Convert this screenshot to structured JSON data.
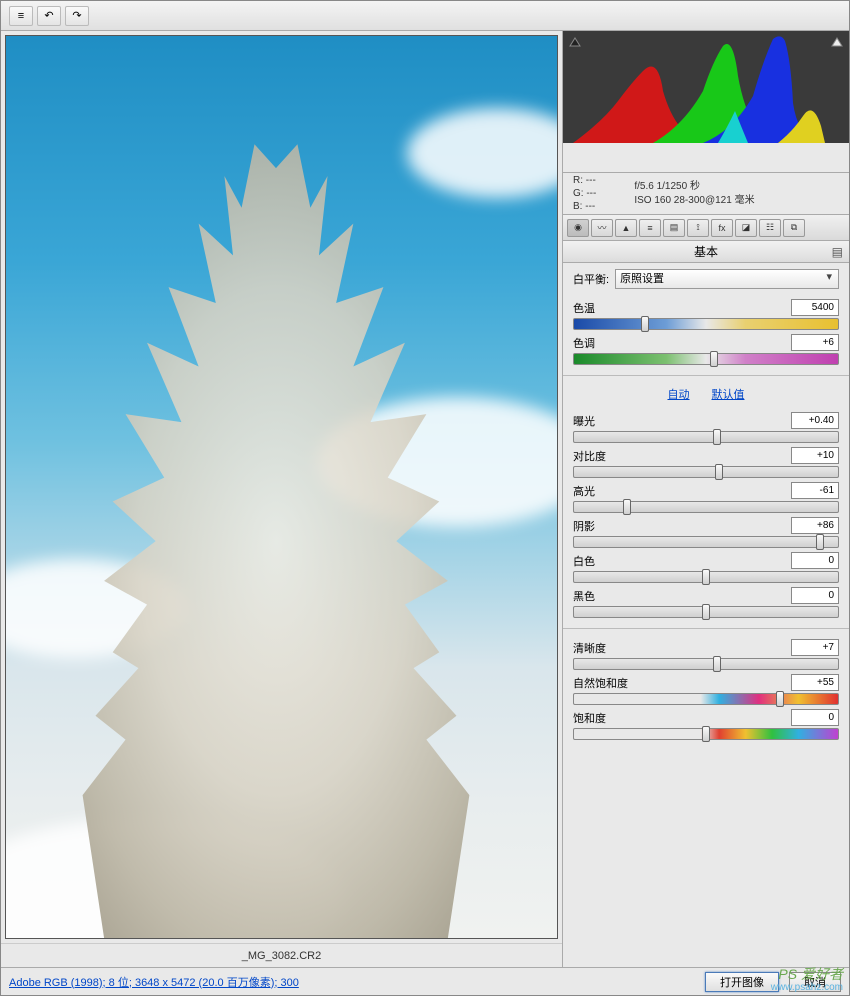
{
  "toolbar": {
    "menu_glyph": "≡",
    "undo_glyph": "↶",
    "redo_glyph": "↷"
  },
  "preview": {
    "filename": "_MG_3082.CR2"
  },
  "histogram": {
    "rgb": {
      "r_label": "R:",
      "g_label": "G:",
      "b_label": "B:",
      "r": "---",
      "g": "---",
      "b": "---"
    },
    "exif_line1": "f/5.6   1/1250 秒",
    "exif_line2": "ISO 160   28-300@121 毫米"
  },
  "panel": {
    "title": "基本",
    "wb_label": "白平衡:",
    "wb_value": "原照设置",
    "auto": "自动",
    "default": "默认值"
  },
  "sliders": {
    "temp": {
      "label": "色温",
      "value": "5400",
      "pos": 27
    },
    "tint": {
      "label": "色调",
      "value": "+6",
      "pos": 53
    },
    "exposure": {
      "label": "曝光",
      "value": "+0.40",
      "pos": 54
    },
    "contrast": {
      "label": "对比度",
      "value": "+10",
      "pos": 55
    },
    "highlights": {
      "label": "高光",
      "value": "-61",
      "pos": 20
    },
    "shadows": {
      "label": "阴影",
      "value": "+86",
      "pos": 93
    },
    "whites": {
      "label": "白色",
      "value": "0",
      "pos": 50
    },
    "blacks": {
      "label": "黑色",
      "value": "0",
      "pos": 50
    },
    "clarity": {
      "label": "清晰度",
      "value": "+7",
      "pos": 54
    },
    "vibrance": {
      "label": "自然饱和度",
      "value": "+55",
      "pos": 78
    },
    "saturation": {
      "label": "饱和度",
      "value": "0",
      "pos": 50
    }
  },
  "footer": {
    "info": "Adobe RGB (1998); 8 位; 3648 x 5472 (20.0 百万像素); 300",
    "open": "打开图像",
    "cancel": "取消"
  },
  "watermark": {
    "text": "PS 爱好者",
    "url": "www.psahz.com"
  }
}
